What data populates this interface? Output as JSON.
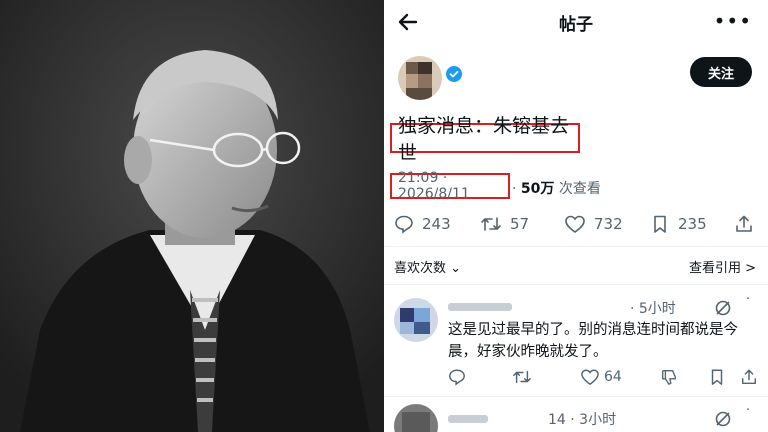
{
  "header": {
    "title": "帖子",
    "back_icon": "arrow-left-icon",
    "more_icon": "more-horizontal-icon",
    "more_text": "•••"
  },
  "post": {
    "follow_label": "关注",
    "headline": "独家消息：朱镕基去世",
    "timestamp": "21:09 · 2026/8/11",
    "views_sep": " · ",
    "views_count": "50万",
    "views_label": " 次查看",
    "reply_count": "243",
    "repost_count": "57",
    "like_count": "732",
    "bookmark_count": "235"
  },
  "stats_bar": {
    "likes_label": "喜欢次数",
    "likes_chevron": "⌄",
    "quotes_label": "查看引用 >"
  },
  "replies": [
    {
      "time": "· 5小时",
      "more_text": "·",
      "text": "这是见过最早的了。别的消息连时间都说是今晨，好家伙昨晚就发了。",
      "like_count": "64"
    },
    {
      "time": "14 · 3小时",
      "more_text": "·"
    }
  ],
  "colors": {
    "highlight": "#d81e1e",
    "verified": "#1d9bf0",
    "muted": "#536471",
    "text": "#0f1419"
  }
}
